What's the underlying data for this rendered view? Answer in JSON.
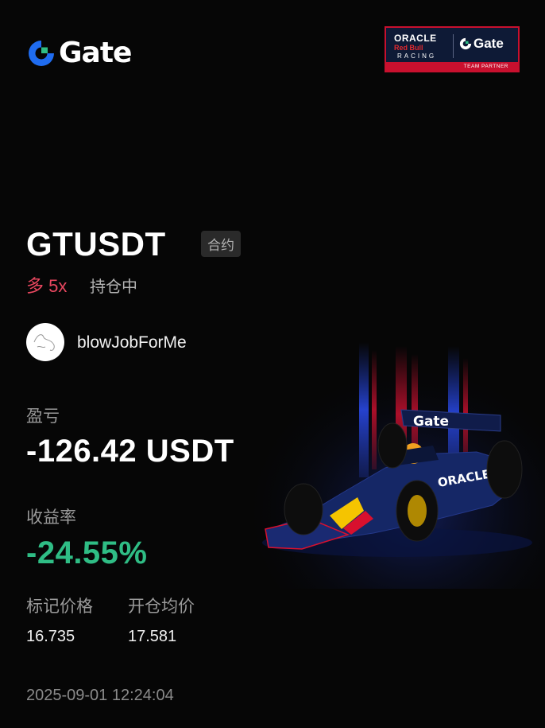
{
  "brand": {
    "name": "Gate",
    "color": "#1f6cf0",
    "accent": "#2fbd85"
  },
  "partner_badge": {
    "line1": "ORACLE",
    "line2": "Red Bull",
    "line3": "RACING",
    "partner_name": "Gate",
    "tagline": "TEAM PARTNER"
  },
  "position": {
    "symbol": "GTUSDT",
    "type_badge": "合约",
    "side": "多 5x",
    "status": "持仓中",
    "side_color": "#e8475f"
  },
  "user": {
    "name": "blowJobForMe"
  },
  "pnl": {
    "label": "盈亏",
    "value": "-126.42 USDT"
  },
  "return_rate": {
    "label": "收益率",
    "value": "-24.55%",
    "color": "#2fbd85"
  },
  "prices": {
    "mark_label": "标记价格",
    "mark_value": "16.735",
    "entry_label": "开仓均价",
    "entry_value": "17.581"
  },
  "timestamp": "2025-09-01 12:24:04",
  "car_livery": {
    "wing_text": "Gate",
    "sidepod_text": "ORACLE"
  }
}
